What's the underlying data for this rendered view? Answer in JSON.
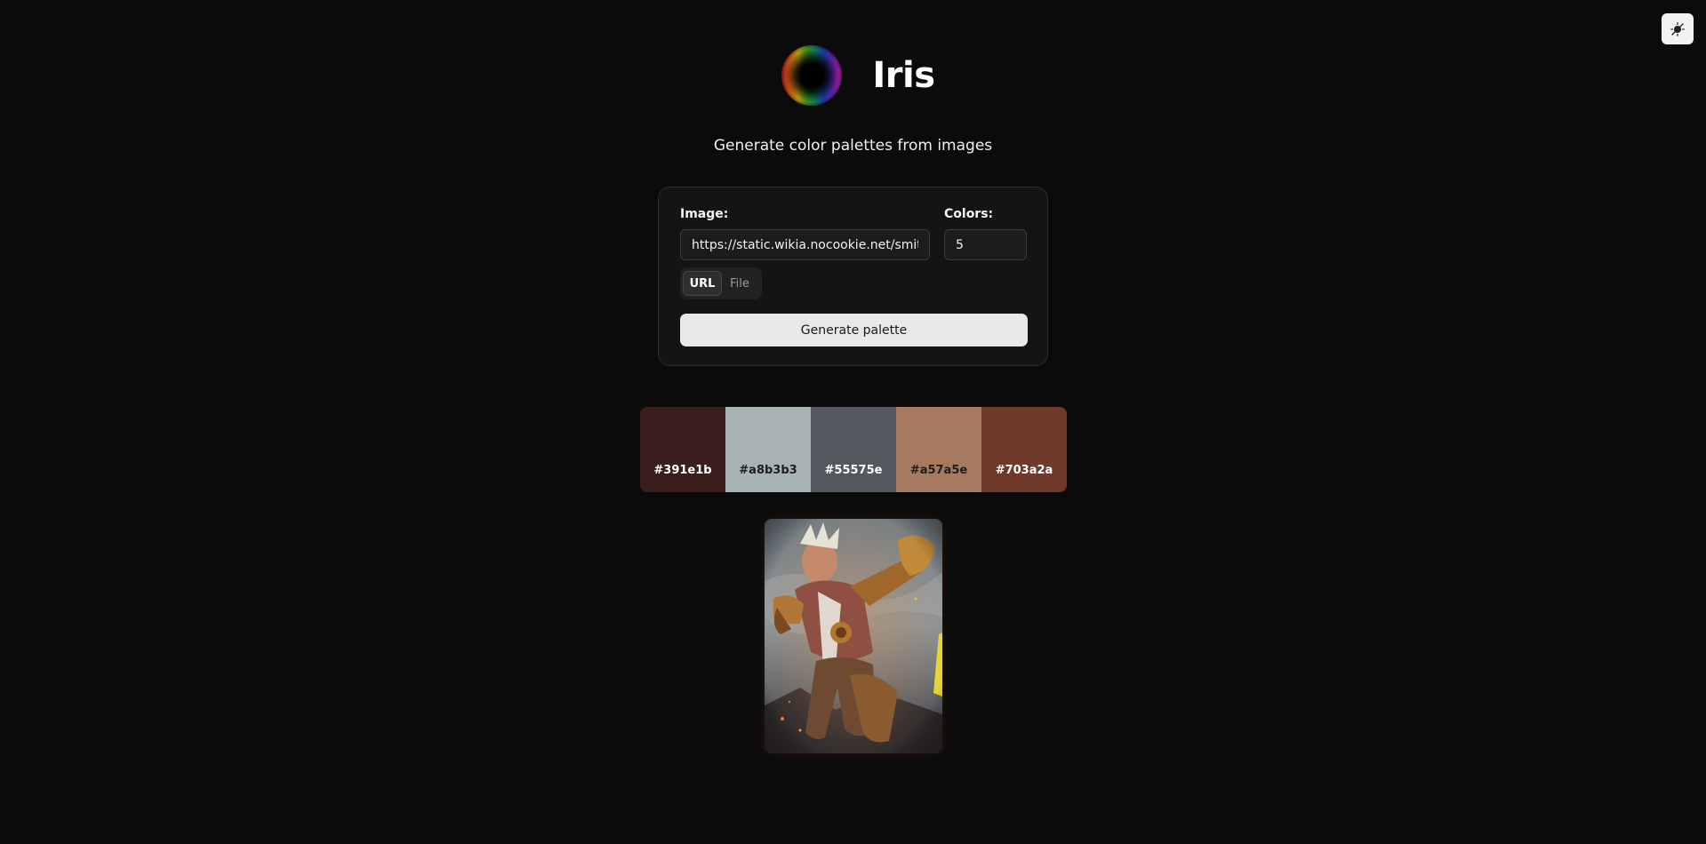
{
  "app": {
    "title": "Iris",
    "subtitle": "Generate color palettes from images",
    "logo_icon": "rainbow-iris-logo"
  },
  "theme_toggle": {
    "icon": "theme-toggle-icon"
  },
  "form": {
    "image_label": "Image:",
    "image_url_value": "https://static.wikia.nocookie.net/smite_",
    "colors_label": "Colors:",
    "colors_value": "5",
    "source_tabs": [
      {
        "label": "URL",
        "selected": true
      },
      {
        "label": "File",
        "selected": false
      }
    ],
    "generate_label": "Generate palette"
  },
  "palette": [
    {
      "hex": "#391e1b",
      "text_color": "#ffffff"
    },
    {
      "hex": "#a8b3b3",
      "text_color": "#1e1e1e"
    },
    {
      "hex": "#55575e",
      "text_color": "#ffffff"
    },
    {
      "hex": "#a57a5e",
      "text_color": "#1e1e1e"
    },
    {
      "hex": "#703a2a",
      "text_color": "#ffffff"
    }
  ],
  "preview": {
    "subject": "armored-warrior-artwork"
  }
}
